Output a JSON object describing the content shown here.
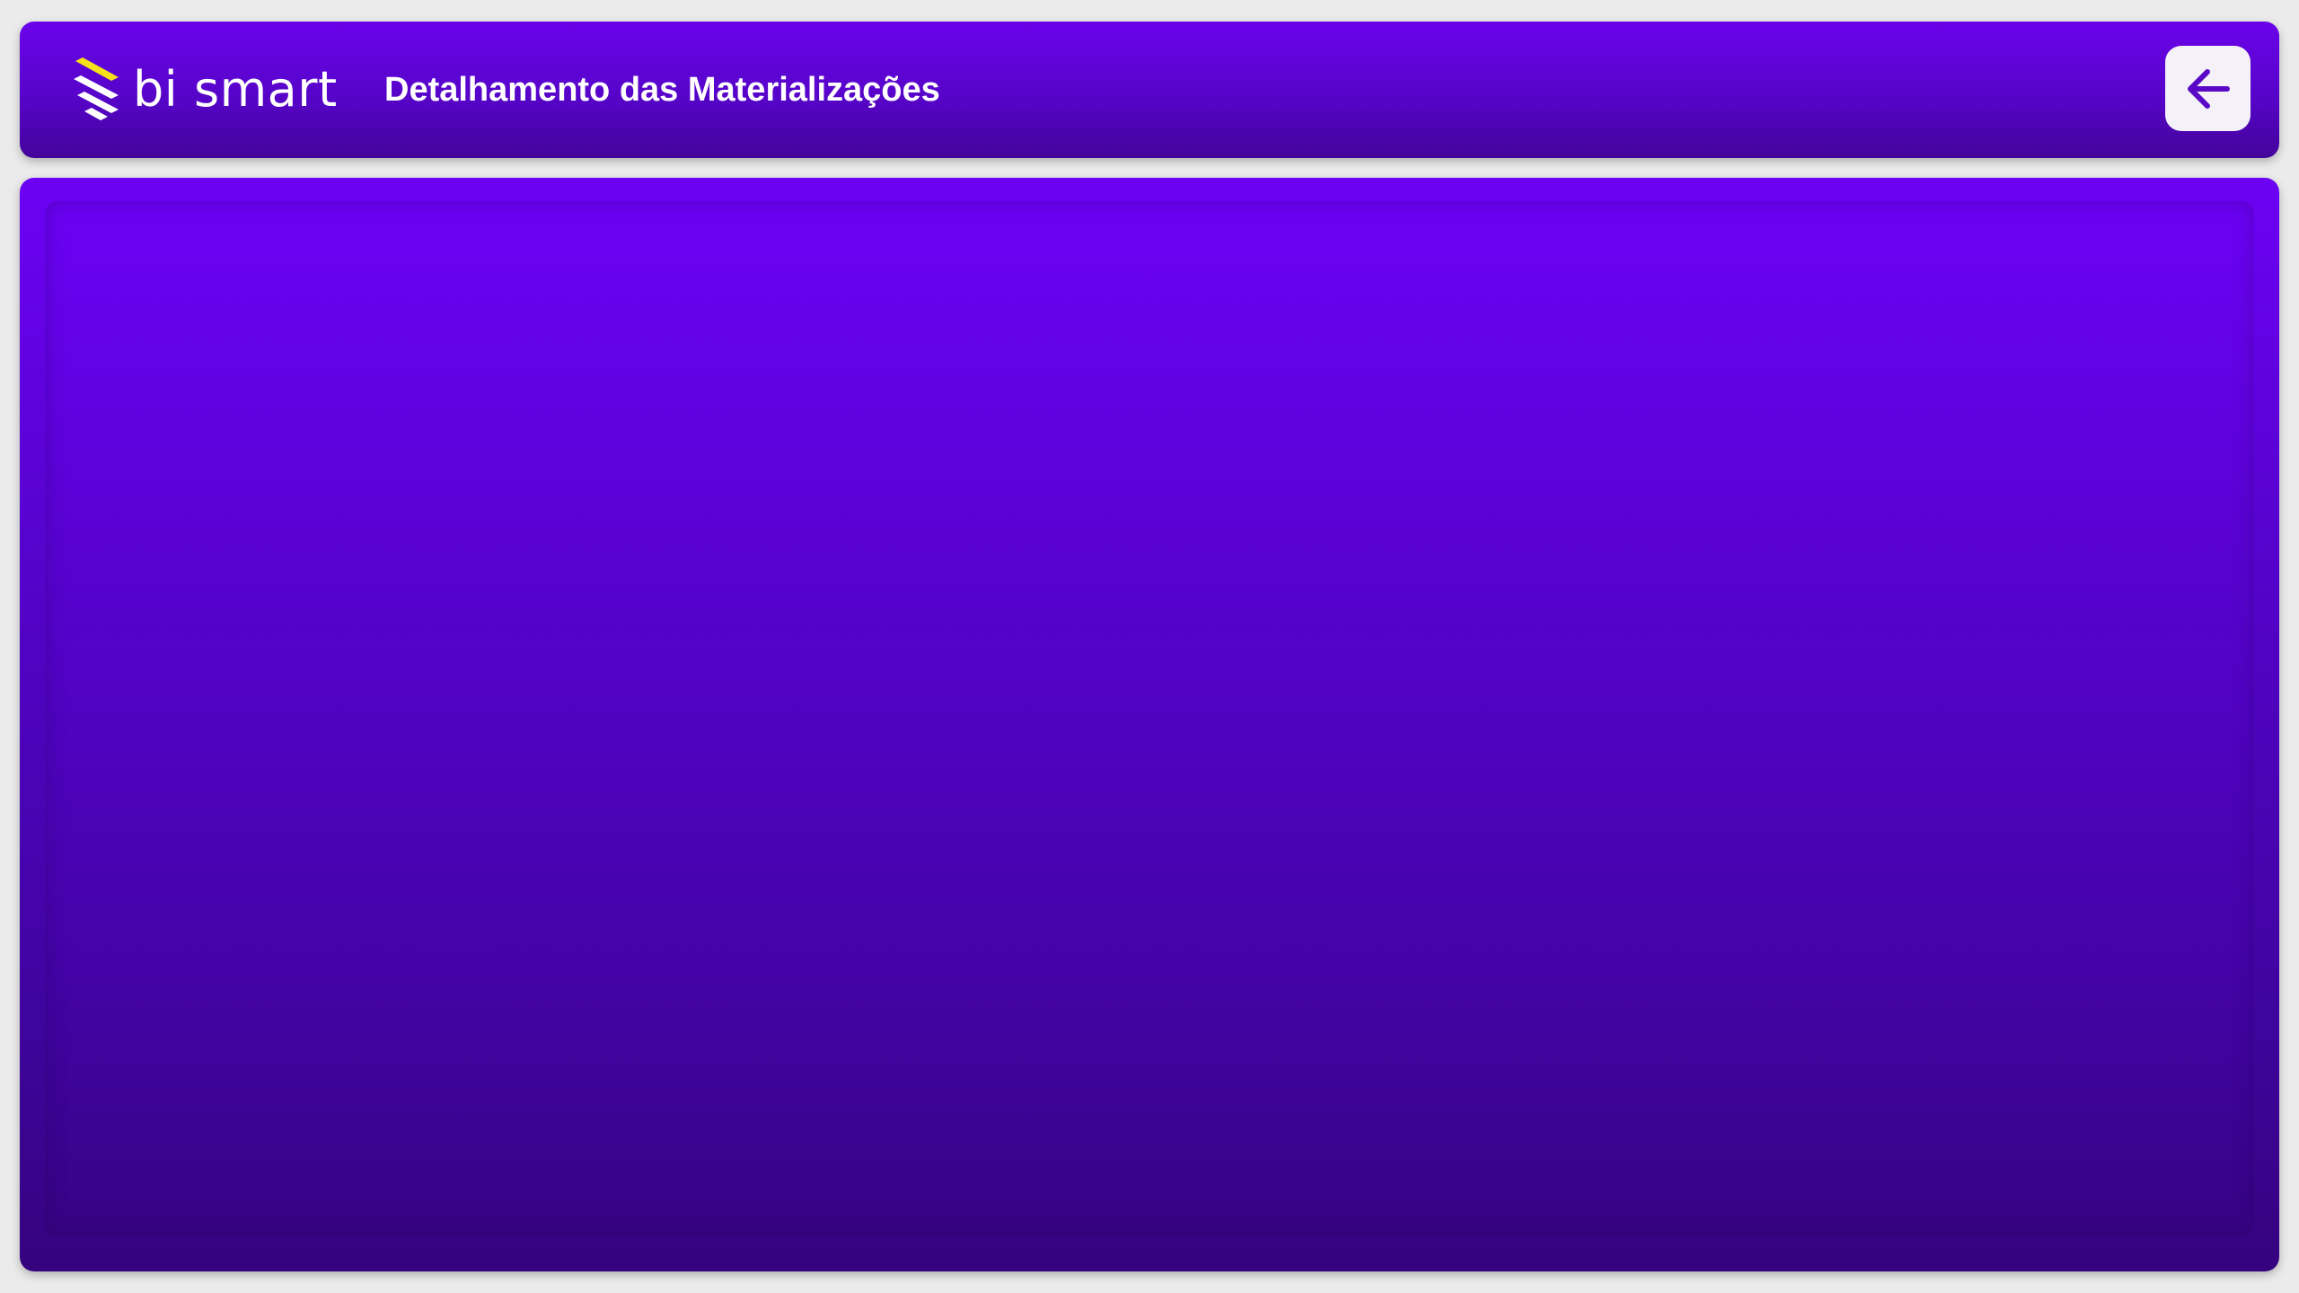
{
  "header": {
    "brand_name": "bi smart",
    "logo_icon": "bi-smart-logo-icon",
    "title": "Detalhamento das Materializações",
    "back_icon": "arrow-left-icon"
  },
  "colors": {
    "page_background": "#ebebeb",
    "header_top": "#6a03ea",
    "header_bottom": "#43049a",
    "panel_top": "#6c02f4",
    "panel_bottom": "#35037e",
    "accent_yellow": "#f5e21b",
    "icon_purple": "#5a08c6",
    "button_background": "#f4f2f8"
  }
}
